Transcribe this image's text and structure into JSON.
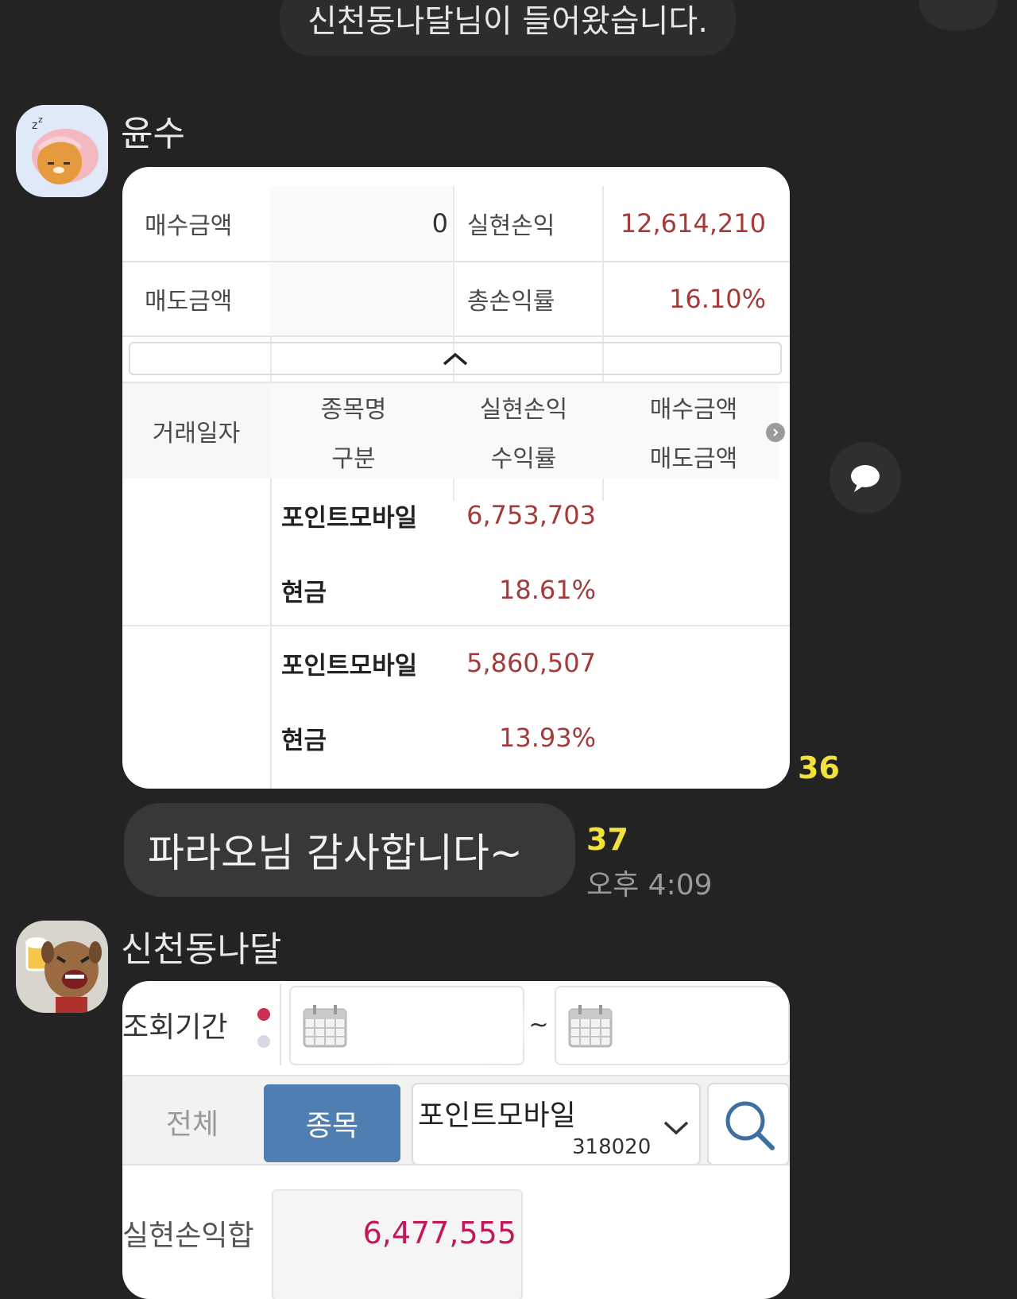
{
  "system_notice": "신천동나달님이 들어왔습니다.",
  "message1": {
    "sender": "윤수",
    "summary": {
      "buy_amount_label": "매수금액",
      "buy_amount_value": "0",
      "realized_pl_label": "실현손익",
      "realized_pl_value": "12,614,210",
      "sell_amount_label": "매도금액",
      "total_return_label": "총손익률",
      "total_return_value": "16.10%"
    },
    "table_headers": {
      "date": "거래일자",
      "stock_name": "종목명",
      "realized_pl": "실현손익",
      "buy_amount": "매수금액",
      "category": "구분",
      "return_rate": "수익률",
      "sell_amount": "매도금액"
    },
    "rows": [
      {
        "stock_name": "포인트모바일",
        "realized_pl": "6,753,703",
        "category": "현금",
        "return_rate": "18.61%"
      },
      {
        "stock_name": "포인트모바일",
        "realized_pl": "5,860,507",
        "category": "현금",
        "return_rate": "13.93%"
      }
    ],
    "unread_count": "36"
  },
  "message2": {
    "text": "파라오님 감사합니다~",
    "unread_count": "37",
    "time": "오후 4:09"
  },
  "message3": {
    "sender": "신천동나달",
    "period_label": "조회기간",
    "tilde": "~",
    "tab_all": "전체",
    "tab_stock": "종목",
    "stock_name": "포인트모바일",
    "stock_code": "318020",
    "realized_pl_sum_label": "실현손익합",
    "realized_pl_sum_value": "6,477,555"
  },
  "colors": {
    "background": "#232323",
    "profit_red": "#a53a3a",
    "unread_yellow": "#f2e03d",
    "tab_active": "#4f7fb0"
  }
}
